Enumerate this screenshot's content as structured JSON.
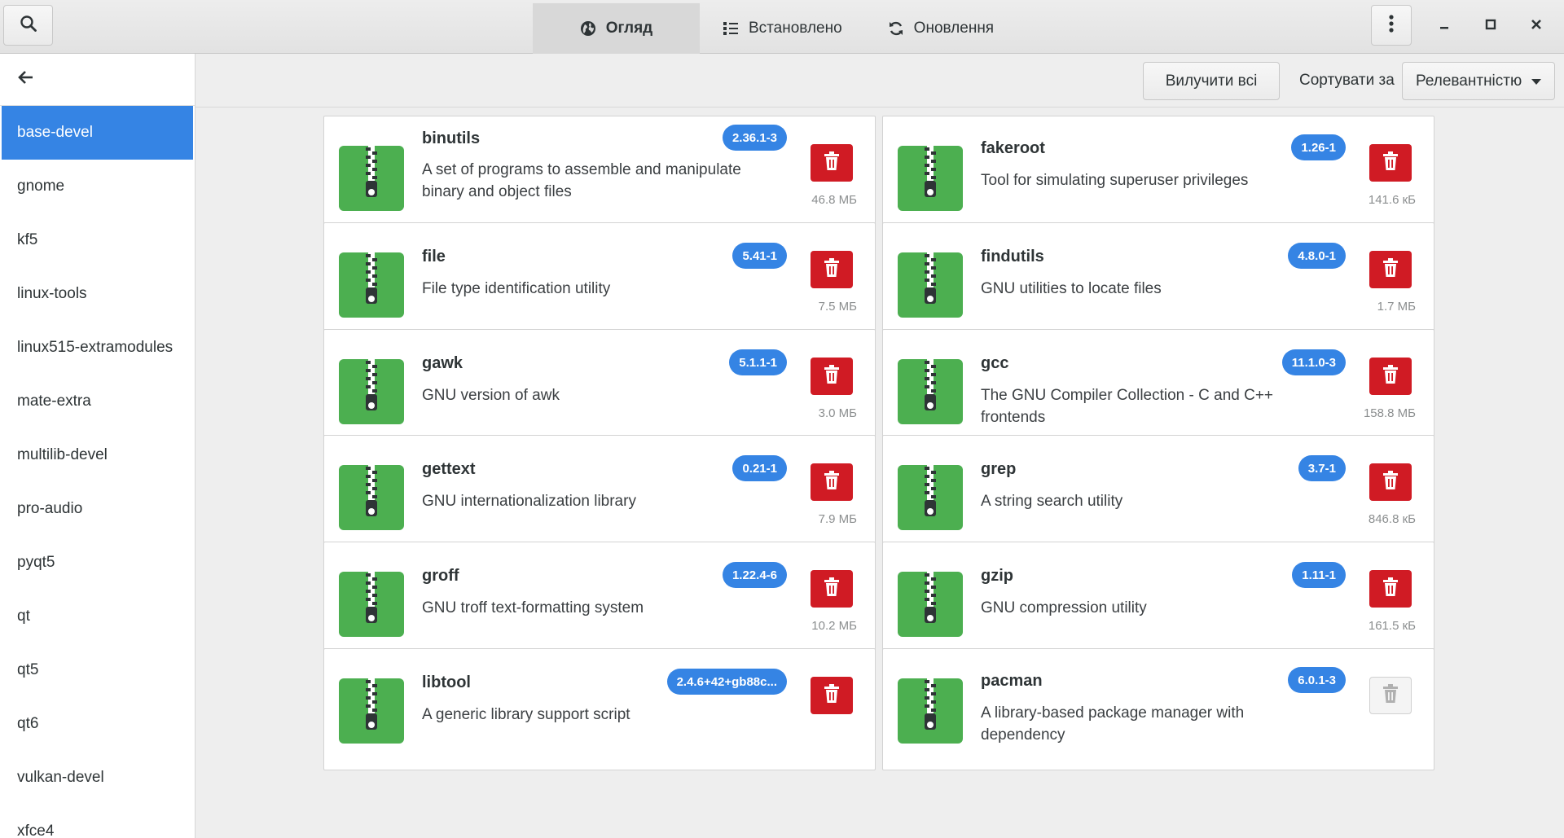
{
  "header": {
    "tabs": [
      {
        "label": "Огляд",
        "icon": "globe-icon",
        "active": true
      },
      {
        "label": "Встановлено",
        "icon": "list-icon",
        "active": false
      },
      {
        "label": "Оновлення",
        "icon": "refresh-icon",
        "active": false
      }
    ],
    "buttons": [
      "search-icon",
      "menu-icon",
      "minimize-icon",
      "maximize-icon",
      "close-icon"
    ]
  },
  "sidebar": {
    "back_icon": "arrow-left-icon",
    "items": [
      {
        "label": "base-devel",
        "selected": true
      },
      {
        "label": "gnome"
      },
      {
        "label": "kf5"
      },
      {
        "label": "linux-tools"
      },
      {
        "label": "linux515-extramodules"
      },
      {
        "label": "mate-extra"
      },
      {
        "label": "multilib-devel"
      },
      {
        "label": "pro-audio"
      },
      {
        "label": "pyqt5"
      },
      {
        "label": "qt"
      },
      {
        "label": "qt5"
      },
      {
        "label": "qt6"
      },
      {
        "label": "vulkan-devel"
      },
      {
        "label": "xfce4"
      }
    ]
  },
  "toolbar": {
    "remove_all": "Вилучити всі",
    "sort_label": "Сортувати за",
    "sort_value": "Релевантністю"
  },
  "packages": [
    {
      "name": "binutils",
      "version": "2.36.1-3",
      "desc": "A set of programs to assemble and manipulate binary and object files",
      "size": "46.8 МБ",
      "removable": true
    },
    {
      "name": "fakeroot",
      "version": "1.26-1",
      "desc": "Tool for simulating superuser privileges",
      "size": "141.6 кБ",
      "removable": true
    },
    {
      "name": "file",
      "version": "5.41-1",
      "desc": "File type identification utility",
      "size": "7.5 МБ",
      "removable": true
    },
    {
      "name": "findutils",
      "version": "4.8.0-1",
      "desc": "GNU utilities to locate files",
      "size": "1.7 МБ",
      "removable": true
    },
    {
      "name": "gawk",
      "version": "5.1.1-1",
      "desc": "GNU version of awk",
      "size": "3.0 МБ",
      "removable": true
    },
    {
      "name": "gcc",
      "version": "11.1.0-3",
      "desc": "The GNU Compiler Collection - C and C++ frontends",
      "size": "158.8 МБ",
      "removable": true
    },
    {
      "name": "gettext",
      "version": "0.21-1",
      "desc": "GNU internationalization library",
      "size": "7.9 МБ",
      "removable": true
    },
    {
      "name": "grep",
      "version": "3.7-1",
      "desc": "A string search utility",
      "size": "846.8 кБ",
      "removable": true
    },
    {
      "name": "groff",
      "version": "1.22.4-6",
      "desc": "GNU troff text-formatting system",
      "size": "10.2 МБ",
      "removable": true
    },
    {
      "name": "gzip",
      "version": "1.11-1",
      "desc": "GNU compression utility",
      "size": "161.5 кБ",
      "removable": true
    },
    {
      "name": "libtool",
      "version": "2.4.6+42+gb88c...",
      "desc": "A generic library support script",
      "size": "",
      "removable": true
    },
    {
      "name": "pacman",
      "version": "6.0.1-3",
      "desc": "A library-based package manager with dependency",
      "size": "",
      "removable": false
    }
  ],
  "colors": {
    "accent": "#3584e4",
    "danger": "#d01b24",
    "package_icon": "#4caf50"
  }
}
